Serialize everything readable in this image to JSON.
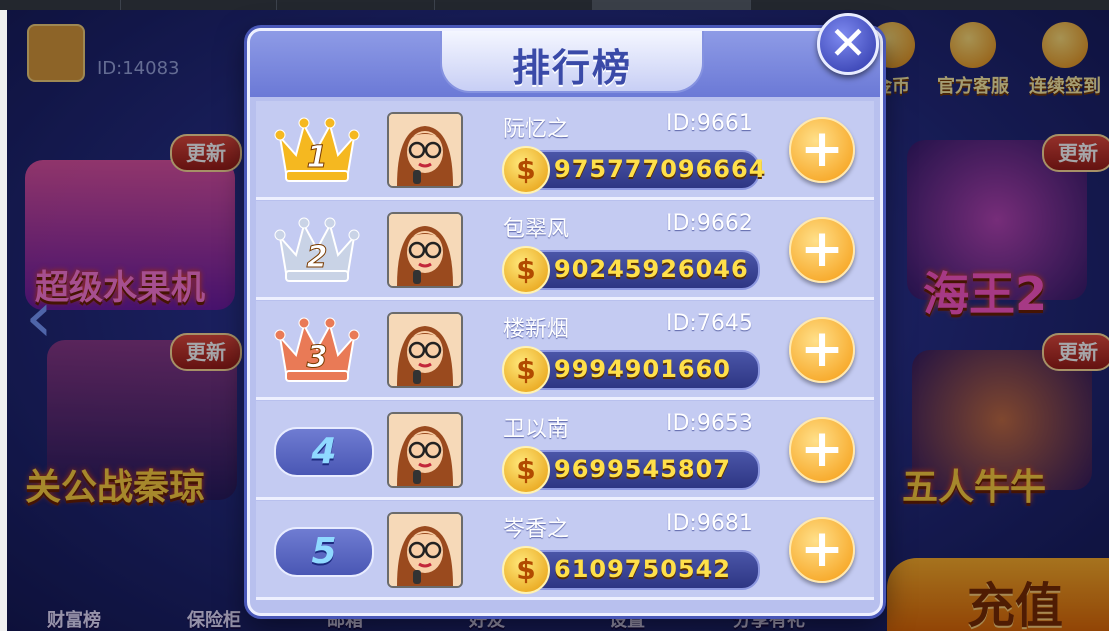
{
  "background": {
    "player_id": "ID:14083",
    "top_icons": [
      {
        "label": "金币",
        "icon": "coin-stack-icon"
      },
      {
        "label": "官方客服",
        "icon": "support-icon"
      },
      {
        "label": "连续签到",
        "icon": "checkin-icon"
      }
    ],
    "game_cards": [
      {
        "name": "超级水果机",
        "badge": "更新"
      },
      {
        "name": "关公战秦琼",
        "badge": "更新"
      },
      {
        "name": "海王2",
        "badge": "更新"
      },
      {
        "name": "五人牛牛",
        "badge": "更新"
      }
    ],
    "bottom_nav": [
      "财富榜",
      "保险柜",
      "邮箱",
      "好友",
      "设置",
      "分享有礼"
    ],
    "recharge_label": "充值"
  },
  "modal": {
    "title": "排行榜",
    "close_icon": "close-icon",
    "rows": [
      {
        "rank": "1",
        "name": "阮忆之",
        "id": "ID:9661",
        "coins": "975777096664",
        "crown": "gold"
      },
      {
        "rank": "2",
        "name": "包翠风",
        "id": "ID:9662",
        "coins": "90245926046",
        "crown": "silver"
      },
      {
        "rank": "3",
        "name": "楼新烟",
        "id": "ID:7645",
        "coins": "9994901660",
        "crown": "bronze"
      },
      {
        "rank": "4",
        "name": "卫以南",
        "id": "ID:9653",
        "coins": "9699545807",
        "crown": ""
      },
      {
        "rank": "5",
        "name": "岑香之",
        "id": "ID:9681",
        "coins": "6109750542",
        "crown": ""
      }
    ],
    "coin_symbol": "$",
    "add_symbol": "+",
    "close_symbol": "✕"
  },
  "colors": {
    "gold": "#f5b820",
    "silver": "#c9d3e6",
    "bronze": "#e97a56"
  }
}
